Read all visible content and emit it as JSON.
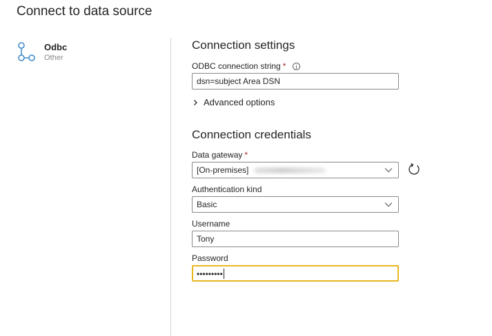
{
  "dialog": {
    "title": "Connect to data source"
  },
  "source": {
    "name": "Odbc",
    "category": "Other",
    "icon": "odbc-connector-icon"
  },
  "connection_settings": {
    "heading": "Connection settings",
    "connection_string_label": "ODBC connection string",
    "required_marker": "*",
    "connection_string_value": "dsn=subject Area DSN",
    "advanced_options_label": "Advanced options"
  },
  "credentials": {
    "heading": "Connection credentials",
    "gateway_label": "Data gateway",
    "gateway_required_marker": "*",
    "gateway_value": "[On-premises]",
    "auth_kind_label": "Authentication kind",
    "auth_kind_value": "Basic",
    "username_label": "Username",
    "username_value": "Tony",
    "password_label": "Password",
    "password_value": "•••••••••"
  },
  "colors": {
    "focus_border": "#e8b720",
    "required": "#a4262c",
    "icon_blue": "#3a87c9"
  }
}
